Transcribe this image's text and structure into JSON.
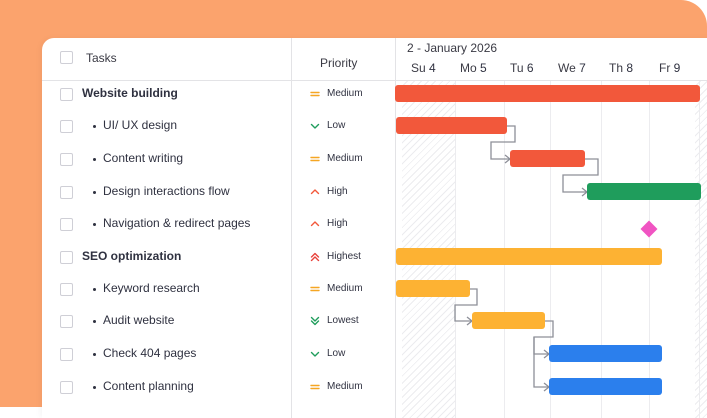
{
  "header": {
    "tasks_label": "Tasks",
    "priority_label": "Priority",
    "month_label": "2 - January 2026",
    "days": [
      {
        "name": "Su",
        "num": "4"
      },
      {
        "name": "Mo",
        "num": "5"
      },
      {
        "name": "Tu",
        "num": "6"
      },
      {
        "name": "We",
        "num": "7"
      },
      {
        "name": "Th",
        "num": "8"
      },
      {
        "name": "Fr",
        "num": "9"
      }
    ]
  },
  "tasks": [
    {
      "label": "Website building",
      "priority": "Medium",
      "parent": true
    },
    {
      "label": "UI/ UX design",
      "priority": "Low",
      "parent": false
    },
    {
      "label": "Content writing",
      "priority": "Medium",
      "parent": false
    },
    {
      "label": "Design interactions flow",
      "priority": "High",
      "parent": false
    },
    {
      "label": "Navigation & redirect pages",
      "priority": "High",
      "parent": false
    },
    {
      "label": "SEO optimization",
      "priority": "Highest",
      "parent": true
    },
    {
      "label": "Keyword research",
      "priority": "Medium",
      "parent": false
    },
    {
      "label": "Audit website",
      "priority": "Lowest",
      "parent": false
    },
    {
      "label": "Check 404 pages",
      "priority": "Low",
      "parent": false
    },
    {
      "label": "Content planning",
      "priority": "Medium",
      "parent": false
    }
  ],
  "colors": {
    "background_accent": "#fba36d",
    "bar_red": "#f2583b",
    "bar_green": "#1f9d5c",
    "bar_yellow": "#fdb233",
    "bar_blue": "#2b7fed",
    "milestone_pink": "#f054c2",
    "priority_medium": "#f5a623",
    "priority_low": "#1f9d5c",
    "priority_high": "#f2583b",
    "priority_highest": "#e8413a",
    "priority_lowest": "#1f9d5c",
    "connector": "#8d8f98"
  },
  "icons": {
    "Medium": "equals-icon",
    "Low": "chevron-down-icon",
    "High": "chevron-up-icon",
    "Highest": "double-chevron-up-icon",
    "Lowest": "double-chevron-down-icon"
  }
}
